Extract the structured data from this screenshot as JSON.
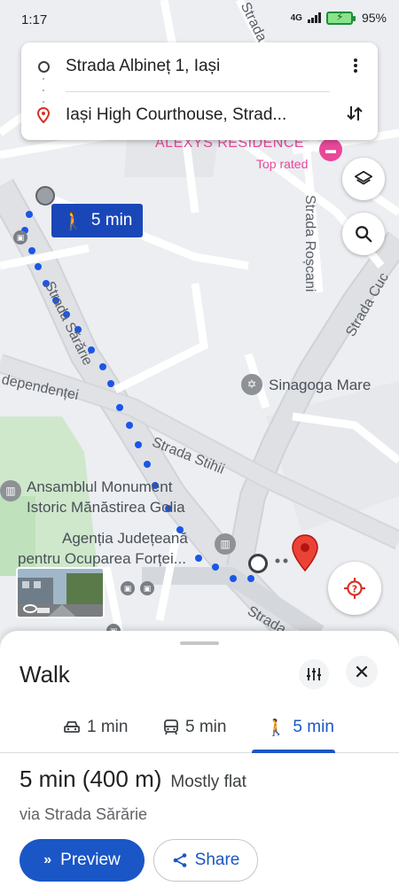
{
  "status_bar": {
    "time": "1:17",
    "network": "4G",
    "battery": "95"
  },
  "route": {
    "origin": "Strada Albineț 1, Iași",
    "destination": "Iași High Courthouse, Strad..."
  },
  "map": {
    "walk_chip": "5 min",
    "labels": {
      "alexys_residence": "ALEXYS RESIDENCE",
      "top_rated": "Top rated",
      "strada_roscani": "Strada Roșcani",
      "strada_cuc": "Strada Cuc",
      "strada_sararie": "Strada Sărărie",
      "sinagoga_mare": "Sinagoga Mare",
      "independentei": "dependenței",
      "strada_stihii": "Strada Stihii",
      "golia_line1": "Ansamblul Monument",
      "golia_line2": "Istoric Mănăstirea Golia",
      "agentia_line1": "Agenția Județeană",
      "agentia_line2": "pentru Ocuparea Forței...",
      "strada_bottom": "Strada",
      "strada_top": "Strada Ro"
    },
    "icons": {
      "layers": "layers-icon",
      "search": "search-icon",
      "locate": "my-location-icon",
      "destination": "red-pin-icon"
    },
    "colors": {
      "route_dots": "#1a56e8",
      "pin": "#ea4335",
      "hotel": "#e8489a"
    }
  },
  "sheet": {
    "title": "Walk",
    "modes": [
      {
        "icon": "car-icon",
        "label": "1 min"
      },
      {
        "icon": "transit-icon",
        "label": "5 min"
      },
      {
        "icon": "walk-icon",
        "label": "5 min",
        "active": true
      }
    ],
    "summary_time": "5 min (400 m)",
    "summary_desc": "Mostly flat",
    "via": "via Strada Sărărie",
    "preview_label": "Preview",
    "share_label": "Share"
  }
}
